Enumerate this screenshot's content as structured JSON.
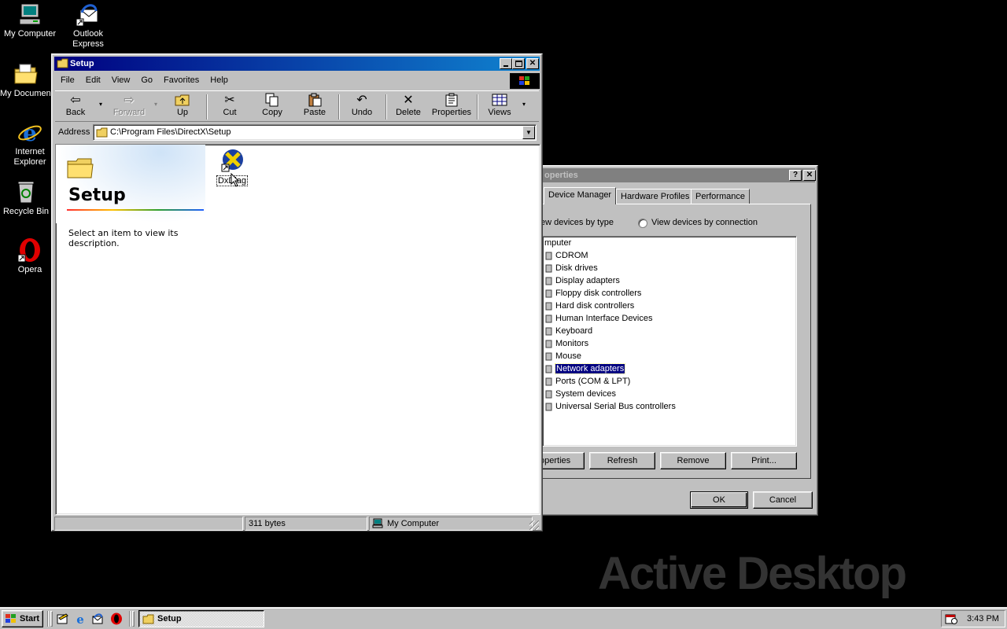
{
  "desktop": {
    "icons": [
      {
        "label": "My Computer"
      },
      {
        "label": "Outlook Express"
      },
      {
        "label": "My Documents"
      },
      {
        "label": "Internet Explorer"
      },
      {
        "label": "Recycle Bin"
      },
      {
        "label": "Opera"
      }
    ],
    "watermark": "Active Desktop"
  },
  "explorer": {
    "title": "Setup",
    "menu": [
      "File",
      "Edit",
      "View",
      "Go",
      "Favorites",
      "Help"
    ],
    "toolbar": {
      "back": "Back",
      "forward": "Forward",
      "up": "Up",
      "cut": "Cut",
      "copy": "Copy",
      "paste": "Paste",
      "undo": "Undo",
      "delete": "Delete",
      "properties": "Properties",
      "views": "Views"
    },
    "address_label": "Address",
    "address": "C:\\Program Files\\DirectX\\Setup",
    "web_panel": {
      "folder_title": "Setup",
      "description": "Select an item to view its description."
    },
    "files": [
      {
        "name": "DxDiag"
      }
    ],
    "status": {
      "size": "311 bytes",
      "zone": "My Computer"
    }
  },
  "dialog": {
    "title": "System Properties",
    "visible_title": "operties",
    "tabs": [
      "Device Manager",
      "Hardware Profiles",
      "Performance"
    ],
    "view_by_type": "View devices by type",
    "view_by_connection": "View devices by connection",
    "root": "Computer",
    "root_visible": "mputer",
    "devices": [
      "CDROM",
      "Disk drives",
      "Display adapters",
      "Floppy disk controllers",
      "Hard disk controllers",
      "Human Interface Devices",
      "Keyboard",
      "Monitors",
      "Mouse",
      "Network adapters",
      "Ports (COM & LPT)",
      "System devices",
      "Universal Serial Bus controllers"
    ],
    "selected_device": "Network adapters",
    "buttons": {
      "properties": "operties",
      "refresh": "Refresh",
      "remove": "Remove",
      "print": "Print...",
      "ok": "OK",
      "cancel": "Cancel"
    }
  },
  "taskbar": {
    "start": "Start",
    "task": "Setup",
    "clock": "3:43 PM"
  },
  "colors": {
    "selection": "#000080",
    "face": "#c0c0c0",
    "desktop": "#000000"
  }
}
